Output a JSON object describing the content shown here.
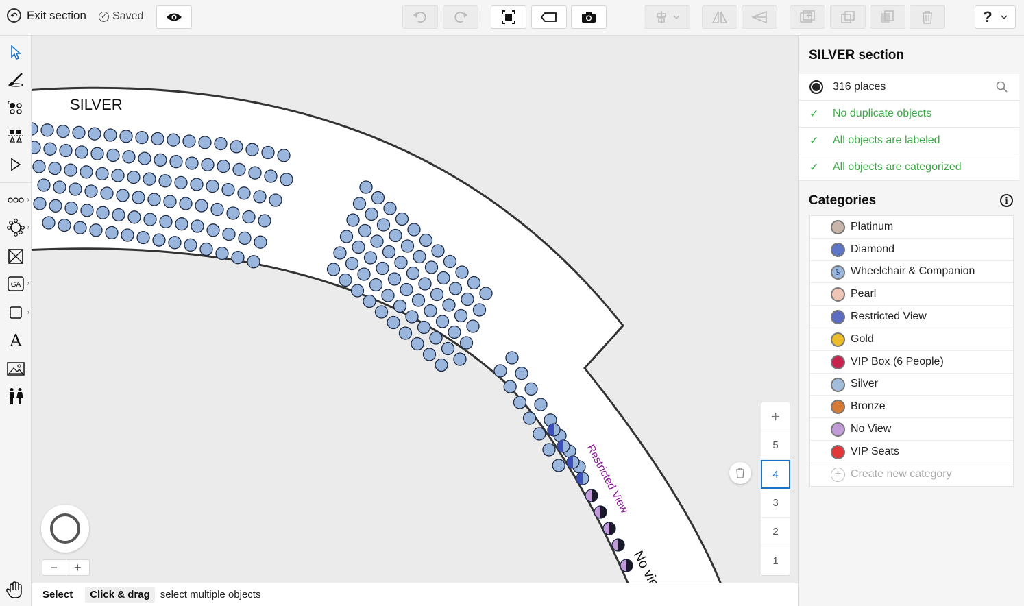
{
  "topbar": {
    "exit_label": "Exit section",
    "saved_label": "Saved",
    "help_label": "?"
  },
  "canvas": {
    "section_label": "SILVER",
    "restricted_label": "Restricted View",
    "noview_label": "No view",
    "seat_color": "#9bb6dc",
    "floors": [
      "+",
      "5",
      "4",
      "3",
      "2",
      "1"
    ],
    "active_floor": "4"
  },
  "status": {
    "mode": "Select",
    "key": "Click & drag",
    "hint": "select multiple objects"
  },
  "panel": {
    "title": "SILVER section",
    "places": "316 places",
    "checks": [
      "No duplicate objects",
      "All objects are labeled",
      "All objects are categorized"
    ],
    "categories_title": "Categories",
    "categories": [
      {
        "label": "Platinum",
        "color": "#c8b6ad"
      },
      {
        "label": "Diamond",
        "color": "#5d76c7"
      },
      {
        "label": "Wheelchair & Companion",
        "color": "#9bb6dc",
        "icon": "wheelchair-icon"
      },
      {
        "label": "Pearl",
        "color": "#efc6b6"
      },
      {
        "label": "Restricted View",
        "color": "#5b6cc2"
      },
      {
        "label": "Gold",
        "color": "#ecbd2b"
      },
      {
        "label": "VIP Box (6 People)",
        "color": "#c8234f"
      },
      {
        "label": "Silver",
        "color": "#a3bddd"
      },
      {
        "label": "Bronze",
        "color": "#d57b36"
      },
      {
        "label": "No View",
        "color": "#c19ad8"
      },
      {
        "label": "VIP Seats",
        "color": "#e2383a"
      }
    ],
    "create_label": "Create new category"
  }
}
